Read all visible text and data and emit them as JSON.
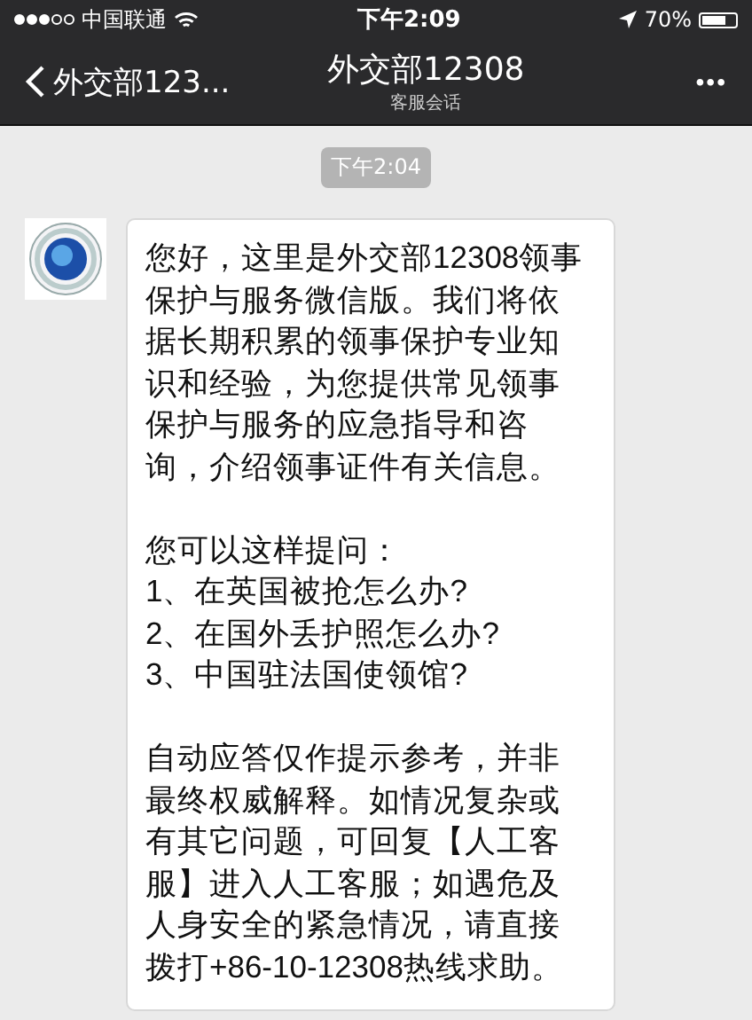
{
  "status_bar": {
    "carrier": "中国联通",
    "time": "下午2:09",
    "battery": "70%"
  },
  "nav": {
    "back": "外交部123...",
    "title": "外交部12308",
    "subtitle": "客服会话",
    "more": "•••"
  },
  "timestamp": "下午2:04",
  "message": {
    "intro": "您好，这里是外交部12308领事保护与服务微信版。我们将依据长期积累的领事保护专业知识和经验，为您提供常见领事保护与服务的应急指导和咨询，介绍领事证件有关信息。",
    "prompt": "您可以这样提问：",
    "questions": [
      "1、在英国被抢怎么办?",
      "2、在国外丢护照怎么办?",
      "3、中国驻法国使领馆?"
    ],
    "disclaimer": "自动应答仅作提示参考，并非最终权威解释。如情况复杂或有其它问题，可回复【人工客服】进入人工客服；如遇危及人身安全的紧急情况，请直接拨打+86-10-12308热线求助。"
  }
}
